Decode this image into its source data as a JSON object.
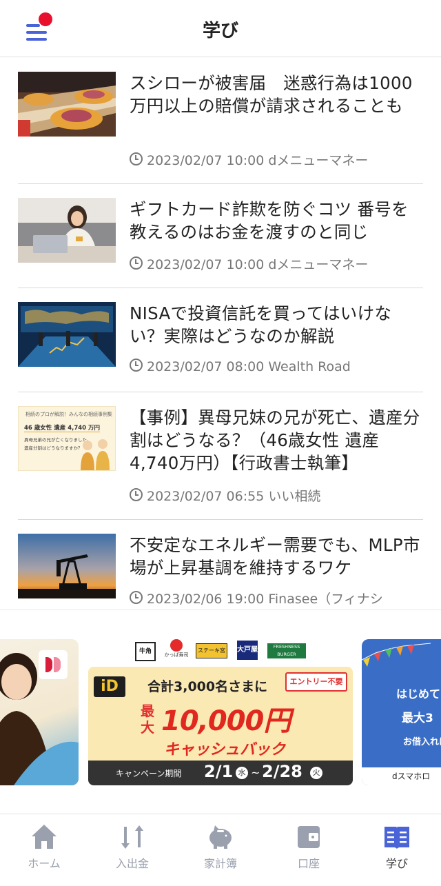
{
  "header": {
    "title": "学び"
  },
  "articles": [
    {
      "title": "スシローが被害届　迷惑行為は1000万円以上の賠償が請求されることも",
      "meta": "2023/02/07 10:00 dメニューマネー",
      "thumb": "sushi-conveyor-image"
    },
    {
      "title": "ギフトカード詐欺を防ぐコツ 番号を教えるのはお金を渡すのと同じ",
      "meta": "2023/02/07 10:00 dメニューマネー",
      "thumb": "woman-laptop-card-image"
    },
    {
      "title": "NISAで投資信託を買ってはいけない？実際はどうなのか解説",
      "meta": "2023/02/07 08:00 Wealth Road",
      "thumb": "investors-screens-image"
    },
    {
      "title": "【事例】異母兄妹の兄が死亡、遺産分割はどうなる？（46歳女性 遺産4,740万円）【行政書士執筆】",
      "meta": "2023/02/07 06:55 いい相続",
      "thumb": "inheritance-case-image",
      "thumb_text": {
        "header": "相続のプロが解説！みんなの相続事例集",
        "line1": "46 歳女性 遺産 4,740 万円",
        "line2": "異母兄弟の兄が亡くなりました。",
        "line3": "遺産分割はどうなりますか？"
      }
    },
    {
      "title": "不安定なエネルギー需要でも、MLP市場が上昇基調を維持するワケ",
      "meta": "2023/02/06 19:00 Finasee（フィナシ",
      "thumb": "oil-pump-sunset-image"
    }
  ],
  "banners": {
    "left": {
      "logo": "d-brand-logo"
    },
    "center": {
      "brands": [
        "牛角",
        "かっぱ寿司",
        "ステーキ宮",
        "大戸屋",
        "FRESHNESS BURGER"
      ],
      "id_logo": "iD",
      "headline": "合計3,000名さまに",
      "entry": "エントリー不要",
      "max_label": "最大",
      "amount": "10,000円",
      "cashback": "キャッシュバック",
      "period_label": "キャンペーン期間",
      "period_start": "2/1",
      "start_day": "水",
      "tilde": "~",
      "period_end": "2/28",
      "end_day": "火"
    },
    "right": {
      "line1": "はじめて",
      "line2": "最大3",
      "line3": "お借入れに",
      "footer": "dスマホロ"
    }
  },
  "tabs": [
    {
      "label": "ホーム",
      "icon": "home-icon"
    },
    {
      "label": "入出金",
      "icon": "transfer-arrows-icon"
    },
    {
      "label": "家計簿",
      "icon": "piggy-bank-icon"
    },
    {
      "label": "口座",
      "icon": "wallet-icon"
    },
    {
      "label": "学び",
      "icon": "book-icon",
      "active": true
    }
  ],
  "colors": {
    "accent": "#4a63d6",
    "badge": "#e8102d",
    "tab_inactive": "#9aa0ad"
  }
}
